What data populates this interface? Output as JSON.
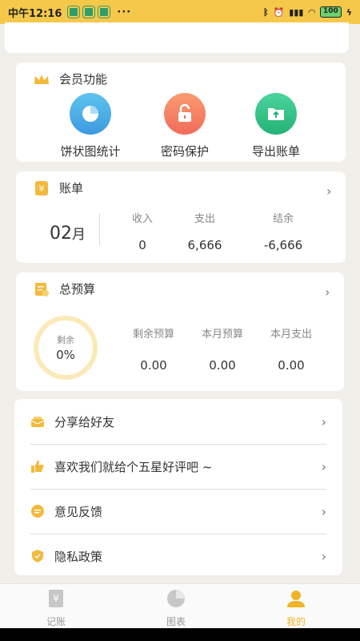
{
  "status_bar": {
    "time": "中午12:16",
    "dots": "···",
    "battery": "100"
  },
  "member": {
    "title": "会员功能",
    "features": [
      {
        "label": "饼状图统计",
        "icon": "pie-chart-icon"
      },
      {
        "label": "密码保护",
        "icon": "unlock-icon"
      },
      {
        "label": "导出账单",
        "icon": "folder-export-icon"
      }
    ]
  },
  "bill": {
    "title": "账单",
    "month_num": "02",
    "month_unit": "月",
    "stats": [
      {
        "label": "收入",
        "value": "0"
      },
      {
        "label": "支出",
        "value": "6,666"
      },
      {
        "label": "结余",
        "value": "-6,666"
      }
    ]
  },
  "budget": {
    "title": "总预算",
    "ring_label": "剩余",
    "ring_value": "0%",
    "stats": [
      {
        "label": "剩余预算",
        "value": "0.00"
      },
      {
        "label": "本月预算",
        "value": "0.00"
      },
      {
        "label": "本月支出",
        "value": "0.00"
      }
    ]
  },
  "menu": [
    {
      "label": "分享给好友",
      "icon": "share-icon"
    },
    {
      "label": "喜欢我们就给个五星好评吧 ~",
      "icon": "thumbs-up-icon"
    },
    {
      "label": "意见反馈",
      "icon": "feedback-icon"
    },
    {
      "label": "隐私政策",
      "icon": "shield-icon"
    }
  ],
  "tabs": [
    {
      "label": "记账"
    },
    {
      "label": "图表"
    },
    {
      "label": "我的"
    }
  ],
  "colors": {
    "accent": "#f6c84a",
    "active_tab": "#f0b429"
  }
}
